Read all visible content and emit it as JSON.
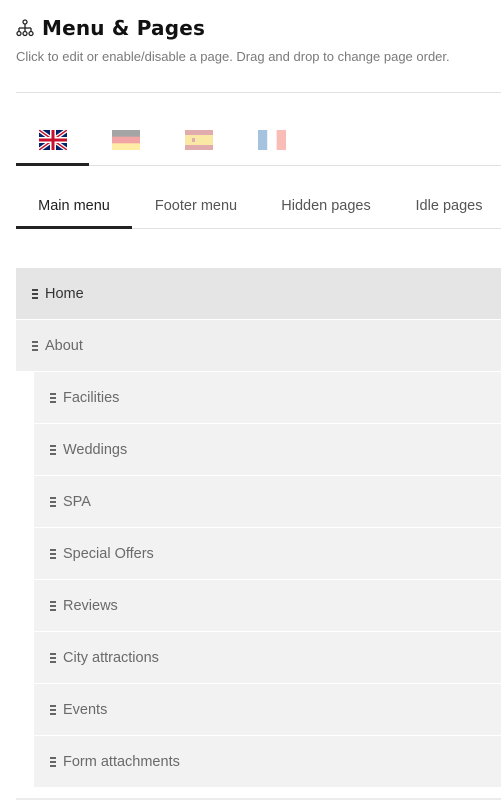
{
  "header": {
    "title": "Menu & Pages",
    "subtitle": "Click to edit or enable/disable a page. Drag and drop to change page order.",
    "icon": "sitemap-icon"
  },
  "languages": [
    {
      "code": "en",
      "icon": "uk-flag-icon",
      "active": true
    },
    {
      "code": "de",
      "icon": "germany-flag-icon",
      "active": false
    },
    {
      "code": "es",
      "icon": "spain-flag-icon",
      "active": false
    },
    {
      "code": "fr",
      "icon": "france-flag-icon",
      "active": false
    }
  ],
  "menu_tabs": [
    {
      "label": "Main menu",
      "active": true
    },
    {
      "label": "Footer menu",
      "active": false
    },
    {
      "label": "Hidden pages",
      "active": false
    },
    {
      "label": "Idle pages",
      "active": false
    }
  ],
  "pages": [
    {
      "label": "Home",
      "level": 0
    },
    {
      "label": "About",
      "level": 0
    },
    {
      "label": "Facilities",
      "level": 1
    },
    {
      "label": "Weddings",
      "level": 1
    },
    {
      "label": "SPA",
      "level": 1
    },
    {
      "label": "Special Offers",
      "level": 1
    },
    {
      "label": "Reviews",
      "level": 1
    },
    {
      "label": "City attractions",
      "level": 1
    },
    {
      "label": "Events",
      "level": 1
    },
    {
      "label": "Form attachments",
      "level": 1
    }
  ],
  "colors": {
    "active_underline": "#222222",
    "row_bg": "#f2f2f2",
    "row_bg_selected": "#e5e5e5"
  }
}
